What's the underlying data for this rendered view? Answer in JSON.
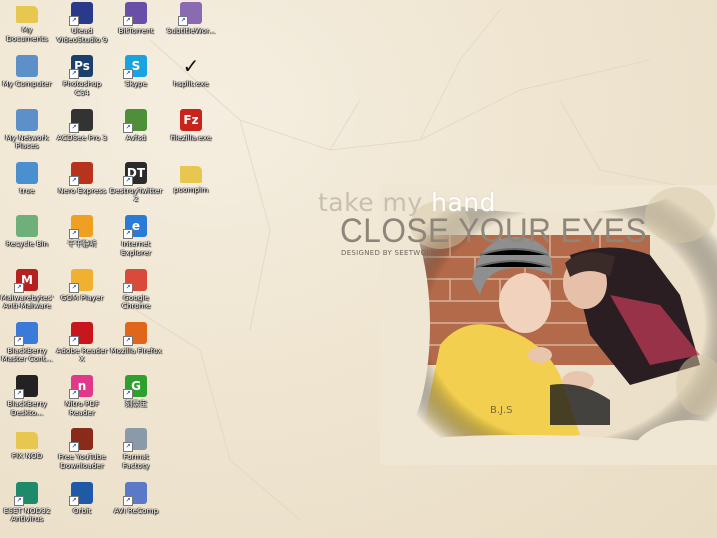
{
  "wallpaper": {
    "line1_a": "take my ",
    "line1_b": "hand",
    "line2": "CLOSE YOUR EYES",
    "line3": "DESIGNED BY SEETWOFM"
  },
  "icons": [
    {
      "label": "My Documents",
      "icon": "folder-documents-icon",
      "color": "#e8c750",
      "glyph": "",
      "shortcut": false
    },
    {
      "label": "Ulead VideoStudio 9",
      "icon": "ulead-videostudio-icon",
      "color": "#2a3a8a",
      "glyph": "",
      "shortcut": true
    },
    {
      "label": "BitTorrent",
      "icon": "bittorrent-icon",
      "color": "#6a4fa8",
      "glyph": "",
      "shortcut": true
    },
    {
      "label": "SubtitleWor...",
      "icon": "subtitle-workshop-icon",
      "color": "#8a6ab0",
      "glyph": "",
      "shortcut": true
    },
    {
      "label": "My Computer",
      "icon": "computer-icon",
      "color": "#5d8fc8",
      "glyph": "",
      "shortcut": false
    },
    {
      "label": "Photoshop CS4",
      "icon": "photoshop-icon",
      "color": "#1d3f6e",
      "glyph": "Ps",
      "shortcut": true
    },
    {
      "label": "Skype",
      "icon": "skype-icon",
      "color": "#1aa3e0",
      "glyph": "S",
      "shortcut": true
    },
    {
      "label": "hsplit.exe",
      "icon": "checkmark-icon",
      "color": "transparent",
      "glyph": "✓",
      "shortcut": false
    },
    {
      "label": "My Network Places",
      "icon": "network-places-icon",
      "color": "#5d8fc8",
      "glyph": "",
      "shortcut": false
    },
    {
      "label": "ACDSee Pro 3",
      "icon": "acdsee-icon",
      "color": "#333333",
      "glyph": "",
      "shortcut": true
    },
    {
      "label": "Avfsd",
      "icon": "avfsd-icon",
      "color": "#4f8f3a",
      "glyph": "",
      "shortcut": true
    },
    {
      "label": "filezilla.exe",
      "icon": "filezilla-icon",
      "color": "#c8241b",
      "glyph": "Fz",
      "shortcut": false
    },
    {
      "label": "true",
      "icon": "network-true-icon",
      "color": "#4a90d0",
      "glyph": "",
      "shortcut": false
    },
    {
      "label": "Nero Express",
      "icon": "nero-express-icon",
      "color": "#b8331c",
      "glyph": "",
      "shortcut": true
    },
    {
      "label": "DestroyTwitter 2",
      "icon": "destroytwitter-icon",
      "color": "#2b2b2b",
      "glyph": "DT",
      "shortcut": true
    },
    {
      "label": "poompim",
      "icon": "folder-icon",
      "color": "#e8c750",
      "glyph": "",
      "shortcut": false
    },
    {
      "label": "Recycle Bin",
      "icon": "recycle-bin-icon",
      "color": "#6fb07a",
      "glyph": "",
      "shortcut": false
    },
    {
      "label": "千千静听",
      "icon": "ttplayer-icon",
      "color": "#f0a020",
      "glyph": "",
      "shortcut": true
    },
    {
      "label": "Internet Explorer",
      "icon": "internet-explorer-icon",
      "color": "#2a7ad8",
      "glyph": "e",
      "shortcut": true
    },
    {
      "label": "Malwarebytes' Anti-Malware",
      "icon": "malwarebytes-icon",
      "color": "#b52020",
      "glyph": "M",
      "shortcut": true
    },
    {
      "label": "GOM Player",
      "icon": "gom-player-icon",
      "color": "#f0b030",
      "glyph": "",
      "shortcut": true
    },
    {
      "label": "Google Chrome",
      "icon": "google-chrome-icon",
      "color": "#d94a3a",
      "glyph": "",
      "shortcut": true
    },
    {
      "label": "BlackBerry Master Cont...",
      "icon": "blackberry-master-icon",
      "color": "#3a7ad8",
      "glyph": "",
      "shortcut": true
    },
    {
      "label": "Adobe Reader X",
      "icon": "adobe-reader-icon",
      "color": "#c8161d",
      "glyph": "",
      "shortcut": true
    },
    {
      "label": "Mozilla Firefox",
      "icon": "firefox-icon",
      "color": "#e0661a",
      "glyph": "",
      "shortcut": true
    },
    {
      "label": "BlackBerry Deskto...",
      "icon": "blackberry-desktop-icon",
      "color": "#222222",
      "glyph": "",
      "shortcut": true
    },
    {
      "label": "Nitro PDF Reader",
      "icon": "nitro-pdf-icon",
      "color": "#e0388a",
      "glyph": "n",
      "shortcut": true
    },
    {
      "label": "刻录宝",
      "icon": "burner-g-icon",
      "color": "#2ea02e",
      "glyph": "G",
      "shortcut": true
    },
    {
      "label": "FIX NOD",
      "icon": "folder-icon",
      "color": "#e8c750",
      "glyph": "",
      "shortcut": false
    },
    {
      "label": "Free YouTube Downloader",
      "icon": "youtube-downloader-icon",
      "color": "#8a2a1a",
      "glyph": "",
      "shortcut": true
    },
    {
      "label": "Format Factory",
      "icon": "format-factory-icon",
      "color": "#8a9aa8",
      "glyph": "",
      "shortcut": true
    },
    {
      "label": "ESET NOD32 Antivirus",
      "icon": "eset-nod32-icon",
      "color": "#1f8a6a",
      "glyph": "",
      "shortcut": true
    },
    {
      "label": "Orbit",
      "icon": "orbit-icon",
      "color": "#1e5aa8",
      "glyph": "",
      "shortcut": true
    },
    {
      "label": "AVI ReComp",
      "icon": "avi-recomp-icon",
      "color": "#5a7ac8",
      "glyph": "",
      "shortcut": true
    }
  ]
}
